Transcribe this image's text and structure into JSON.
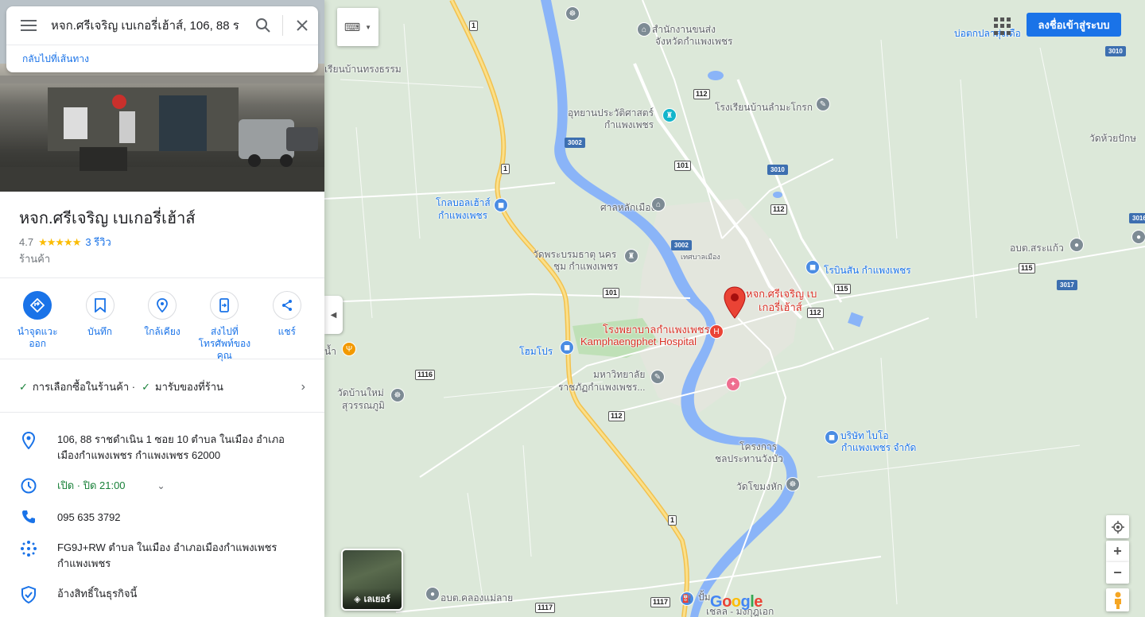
{
  "search": {
    "query": "หจก.ศรีเจริญ เบเกอรี่เฮ้าส์, 106, 88 ร",
    "back_link": "กลับไปที่เส้นทาง"
  },
  "place": {
    "name": "หจก.ศรีเจริญ เบเกอรี่เฮ้าส์",
    "rating": "4.7",
    "stars": "★★★★★",
    "reviews": "3 รีวิว",
    "category": "ร้านค้า"
  },
  "actions": [
    {
      "label": "นำจุดแวะออก",
      "icon": "directions-icon"
    },
    {
      "label": "บันทึก",
      "icon": "bookmark-icon"
    },
    {
      "label": "ใกล้เคียง",
      "icon": "nearby-icon"
    },
    {
      "label": "ส่งไปที่โทรศัพท์ของคุณ",
      "icon": "send-to-phone-icon"
    },
    {
      "label": "แชร์",
      "icon": "share-icon"
    }
  ],
  "features": [
    "การเลือกซื้อในร้านค้า ·",
    "มารับของที่ร้าน"
  ],
  "info": {
    "address": "106, 88 ราชดำเนิน 1 ซอย 10 ตำบล ในเมือง อำเภอเมืองกำแพงเพชร กำแพงเพชร 62000",
    "hours": "เปิด · ปิด 21:00",
    "phone": "095 635 3792",
    "plus_code": "FG9J+RW ตำบล ในเมือง อำเภอเมืองกำแพงเพชร กำแพงเพชร",
    "claim": "อ้างสิทธิ์ในธุรกิจนี้"
  },
  "map": {
    "signin": "ลงชื่อเข้าสู่ระบบ",
    "layers": "เลเยอร์",
    "google": "Google",
    "labels": {
      "l1": "สำนักงานขนส่ง",
      "l1b": "จังหวัดกำแพงเพชร",
      "l2": "บ่อตกปลาสุ่งเดือ",
      "l3": "เรียนบ้านทรงธรรม",
      "l4": "อุทยานประวัติศาสตร์",
      "l4b": "กำแพงเพชร",
      "l5": "โรงเรียนบ้านลำมะโกรก",
      "l6": "วัดห้วยปักษ",
      "l7": "โกลบอลเฮ้าส์",
      "l7b": "กำแพงเพชร",
      "l8": "ศาลหลักเมือง",
      "l9": "วัดพระบรมธาตุ นคร",
      "l9b": "ชุม กำแพงเพชร",
      "l10": "เทศบาลเมือง",
      "l11": "โรบินสัน กำแพงเพชร",
      "l12": "อบต.สระแก้ว",
      "l13": "หจก.ศรีเจริญ เบ",
      "l13b": "เกอรี่เฮ้าส์",
      "l14": "โรงพยาบาลกำแพงเพชร",
      "l14b": "Kamphaengphet Hospital",
      "l15": "โฮมโปร",
      "l16": "มหาวิทยาลัย",
      "l16b": "ราชภัฏกำแพงเพชร...",
      "l17": "วัดบ้านใหม่",
      "l17b": "สุวรรณภูมิ",
      "l18": "โครงการ",
      "l18b": "ชลประทานวังบัว",
      "l19": "บริษัท ไบโอ",
      "l19b": "กำแพงเพชร จำกัด",
      "l20": "วัดโขมงหัก",
      "l21": "อบต.คลองแม่ลาย",
      "l22": "ปั้ม",
      "l22b": "เชลล - มงกุฎเอก",
      "l23": "น้ำ"
    },
    "shields": {
      "s1": "1",
      "s2": "1",
      "s3": "112",
      "s4": "3002",
      "s5": "101",
      "s6": "3010",
      "s7": "112",
      "s8": "3002",
      "s9": "101",
      "s10": "115",
      "s11": "3017",
      "s12": "112",
      "s13": "1116",
      "s14": "112",
      "s15": "1",
      "s16": "1117",
      "s17": "1117",
      "s18": "3010",
      "s19": "115",
      "s20": "3016"
    },
    "colors": {
      "water": "#8ab4f8",
      "land": "#dce8d9",
      "highway": "#f6cf65",
      "accent": "#1a73e8"
    }
  }
}
